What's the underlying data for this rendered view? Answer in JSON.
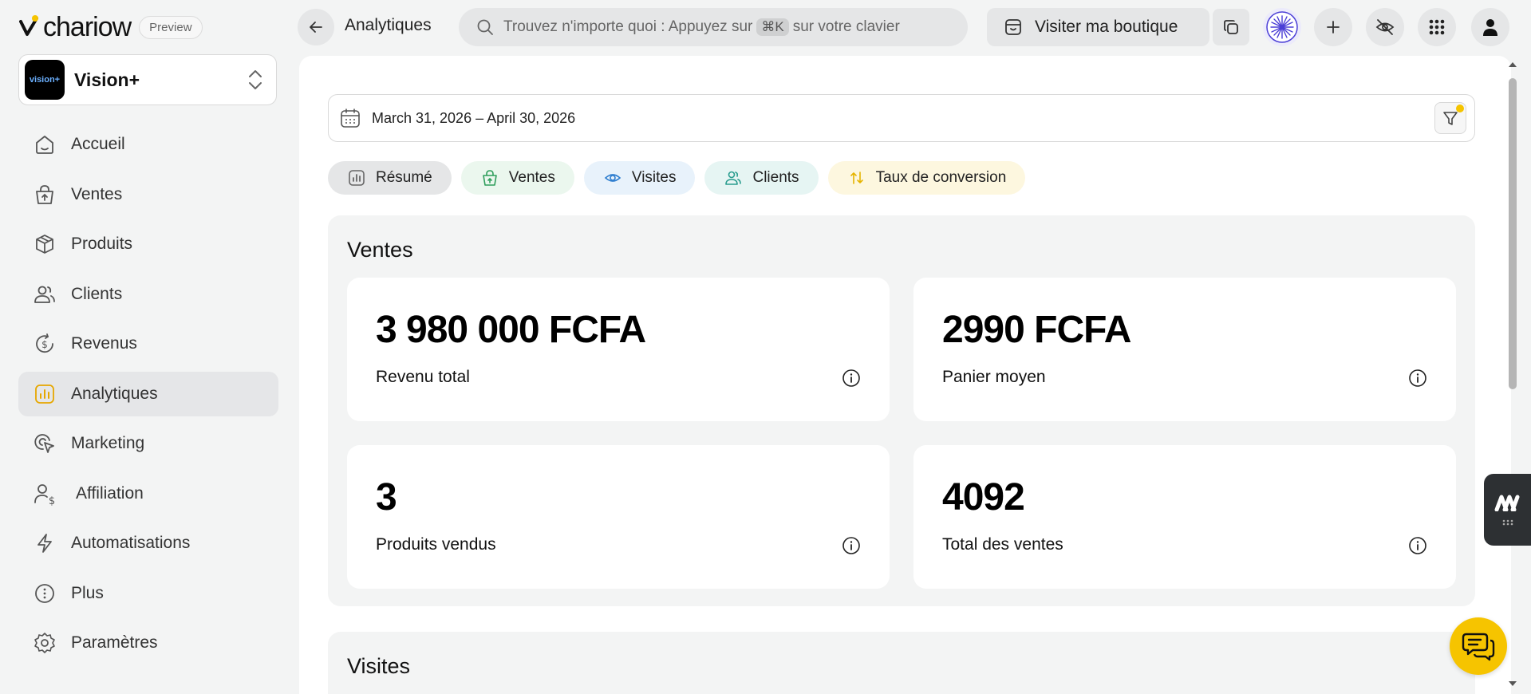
{
  "brand": {
    "name": "chariow",
    "badge": "Preview"
  },
  "store": {
    "name": "Vision+",
    "avatar_text": "vision+"
  },
  "sidebar": {
    "items": [
      {
        "label": "Accueil",
        "icon": "home-icon"
      },
      {
        "label": "Ventes",
        "icon": "shopping-bag-icon"
      },
      {
        "label": "Produits",
        "icon": "box-icon"
      },
      {
        "label": "Clients",
        "icon": "users-icon"
      },
      {
        "label": "Revenus",
        "icon": "dollar-refresh-icon"
      },
      {
        "label": "Analytiques",
        "icon": "bar-chart-icon",
        "active": true
      },
      {
        "label": "Marketing",
        "icon": "target-pointer-icon"
      },
      {
        "label": "Affiliation",
        "icon": "user-dollar-icon"
      },
      {
        "label": "Automatisations",
        "icon": "lightning-icon"
      },
      {
        "label": "Plus",
        "icon": "more-circle-icon"
      },
      {
        "label": "Paramètres",
        "icon": "gear-icon"
      }
    ]
  },
  "header": {
    "title": "Analytiques",
    "search": {
      "prefix": "Trouvez n'importe quoi : Appuyez sur",
      "shortcut": "⌘K",
      "suffix": "sur votre clavier"
    },
    "visit_store_label": "Visiter ma boutique"
  },
  "filters": {
    "date_range": "March 31, 2026 – April 30, 2026"
  },
  "tabs": [
    {
      "label": "Résumé",
      "bg": "#e5e6e7",
      "icon_color": "#666"
    },
    {
      "label": "Ventes",
      "bg": "#ebf7ee",
      "icon_color": "#2e9e5b"
    },
    {
      "label": "Visites",
      "bg": "#e8f2fb",
      "icon_color": "#2f7ecf"
    },
    {
      "label": "Clients",
      "bg": "#e6f5f3",
      "icon_color": "#2a9d8f"
    },
    {
      "label": "Taux de conversion",
      "bg": "#fdf7df",
      "icon_color": "#e6b400"
    }
  ],
  "sales": {
    "title": "Ventes",
    "cards": [
      {
        "value": "3 980 000 FCFA",
        "label": "Revenu total"
      },
      {
        "value": "2990 FCFA",
        "label": "Panier moyen"
      },
      {
        "value": "3",
        "label": "Produits vendus"
      },
      {
        "value": "4092",
        "label": "Total des ventes"
      }
    ]
  },
  "visits": {
    "title": "Visites"
  },
  "colors": {
    "accent_yellow": "#f6c400",
    "analytics_icon": "#e6a700",
    "star_purple": "#4b3fd6"
  }
}
